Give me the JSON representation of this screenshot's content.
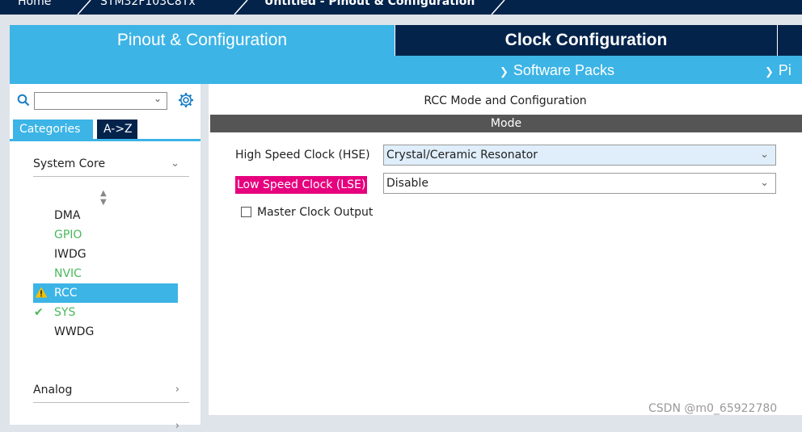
{
  "breadcrumb": {
    "home": "Home",
    "device": "STM32F103C8Tx",
    "current": "Untitled - Pinout & Configuration"
  },
  "tabs": {
    "pinout": "Pinout & Configuration",
    "clock": "Clock Configuration"
  },
  "subbar": {
    "software_packs": "Software Packs",
    "pinout_partial": "Pi"
  },
  "left": {
    "search": {
      "value": "",
      "placeholder": ""
    },
    "category_tabs": [
      "Categories",
      "A->Z"
    ],
    "groups": {
      "system_core": "System Core",
      "analog": "Analog"
    },
    "items": [
      {
        "label": "DMA",
        "status": "none"
      },
      {
        "label": "GPIO",
        "status": "green"
      },
      {
        "label": "IWDG",
        "status": "none"
      },
      {
        "label": "NVIC",
        "status": "green"
      },
      {
        "label": "RCC",
        "status": "warning",
        "selected": true
      },
      {
        "label": "SYS",
        "status": "ok"
      },
      {
        "label": "WWDG",
        "status": "none"
      }
    ]
  },
  "right": {
    "title": "RCC Mode and Configuration",
    "mode_header": "Mode",
    "hse": {
      "label": "High Speed Clock (HSE)",
      "value": "Crystal/Ceramic Resonator"
    },
    "lse": {
      "label": "Low Speed Clock (LSE)",
      "value": "Disable"
    },
    "mco": {
      "label": "Master Clock Output",
      "checked": false
    }
  },
  "watermark": "CSDN @m0_65922780",
  "colors": {
    "navy": "#03234b",
    "accent": "#3cb4e6",
    "highlight": "#e6007e",
    "green": "#49b85c",
    "warning": "#f5c000"
  }
}
